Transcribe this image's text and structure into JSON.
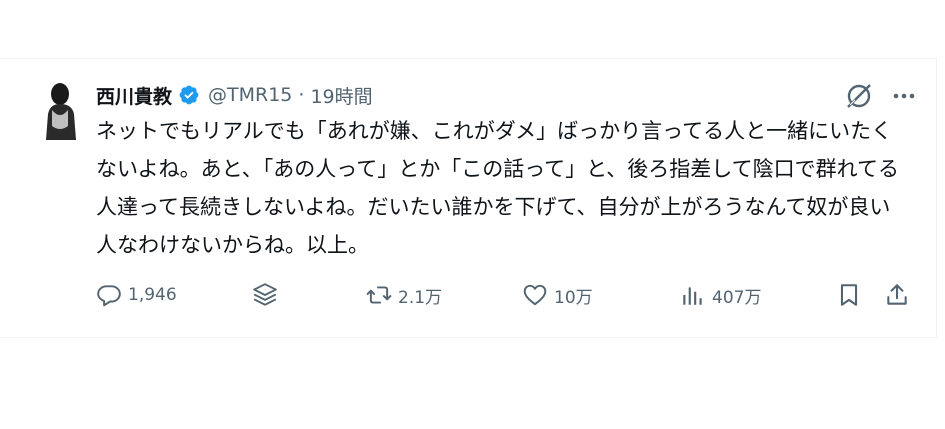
{
  "tweet": {
    "author_name": "西川貴教",
    "handle": "@TMR15",
    "separator": "·",
    "time": "19時間",
    "text": "ネットでもリアルでも「あれが嫌、これがダメ」ばっかり言ってる人と一緒にいたくないよね。あと、「あの人って」とか「この話って」と、後ろ指差して陰口で群れてる人達って長続きしないよね。だいたい誰かを下げて、自分が上がろうなんて奴が良い人なわけないからね。以上。"
  },
  "actions": {
    "reply_count": "1,946",
    "retweet_count": "2.1万",
    "like_count": "10万",
    "view_count": "407万"
  },
  "icons": {
    "verified": "verified-badge-icon",
    "grok": "grok-icon",
    "more": "more-icon",
    "reply": "reply-icon",
    "layers": "layers-icon",
    "retweet": "retweet-icon",
    "like": "heart-icon",
    "views": "views-icon",
    "bookmark": "bookmark-icon",
    "share": "share-icon"
  },
  "colors": {
    "verified": "#1d9bf0",
    "text": "#0f1419",
    "secondary": "#536471",
    "border": "#eff3f4"
  }
}
